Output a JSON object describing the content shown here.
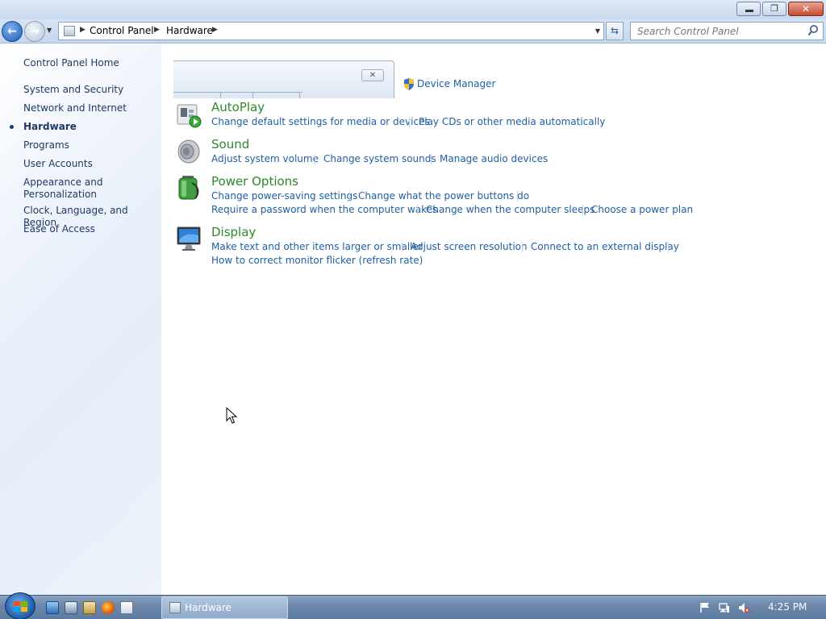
{
  "window": {
    "buttons": {
      "minimize": "",
      "restore": "❐",
      "close": "✕"
    }
  },
  "nav": {
    "back_icon": "back-arrow-icon",
    "forward_icon": "forward-arrow-icon",
    "breadcrumb": [
      "Control Panel",
      "Hardware"
    ],
    "search_placeholder": "Search Control Panel"
  },
  "sidebar": {
    "items": [
      {
        "label": "Control Panel Home"
      },
      {
        "label": "System and Security"
      },
      {
        "label": "Network and Internet"
      },
      {
        "label": "Hardware",
        "current": true
      },
      {
        "label": "Programs"
      },
      {
        "label": "User Accounts"
      },
      {
        "label": "Appearance and Personalization"
      },
      {
        "label": "Clock, Language, and Region"
      },
      {
        "label": "Ease of Access"
      }
    ]
  },
  "main": {
    "device_manager": "Device Manager",
    "categories": [
      {
        "title": "AutoPlay",
        "icon": "autoplay-icon",
        "links": [
          "Change default settings for media or devices",
          "Play CDs or other media automatically"
        ]
      },
      {
        "title": "Sound",
        "icon": "speaker-icon",
        "links": [
          "Adjust system volume",
          "Change system sounds",
          "Manage audio devices"
        ]
      },
      {
        "title": "Power Options",
        "icon": "battery-icon",
        "links": [
          "Change power-saving settings",
          "Change what the power buttons do",
          "Require a password when the computer wakes",
          "Change when the computer sleeps",
          "Choose a power plan"
        ]
      },
      {
        "title": "Display",
        "icon": "monitor-icon",
        "links": [
          "Make text and other items larger or smaller",
          "Adjust screen resolution",
          "Connect to an external display",
          "How to correct monitor flicker (refresh rate)"
        ]
      }
    ]
  },
  "taskbar": {
    "active_window": "Hardware",
    "clock": "4:25 PM"
  },
  "colors": {
    "link": "#1e5fa5",
    "category_title": "#2a8a2a",
    "sidebar_text": "#1e3966"
  }
}
